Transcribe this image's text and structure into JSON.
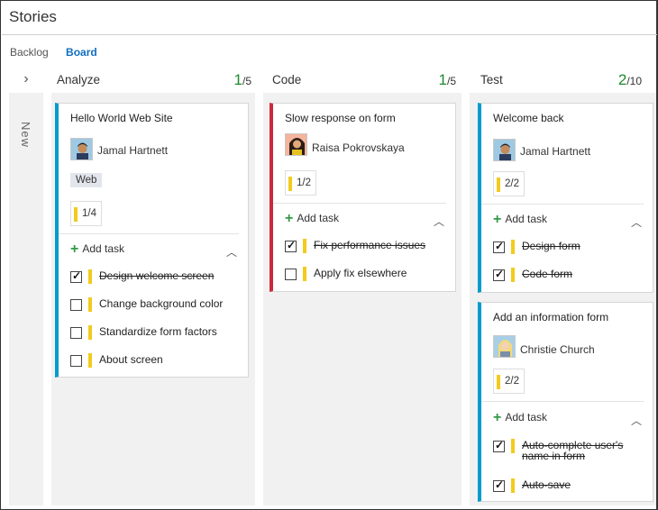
{
  "page": {
    "title": "Stories"
  },
  "tabs": [
    {
      "label": "Backlog"
    },
    {
      "label": "Board"
    }
  ],
  "new_column": {
    "label": "New"
  },
  "columns": [
    {
      "name": "Analyze",
      "count": "1",
      "limit": "/5"
    },
    {
      "name": "Code",
      "count": "1",
      "limit": "/5"
    },
    {
      "name": "Test",
      "count": "2",
      "limit": "/10"
    }
  ],
  "cards": {
    "hello_world": {
      "title": "Hello World Web Site",
      "assignee": "Jamal Hartnett",
      "tag": "Web",
      "progress": "1/4",
      "add_task": "Add task",
      "tasks": [
        {
          "name": "Design welcome screen",
          "done": true
        },
        {
          "name": "Change background color",
          "done": false
        },
        {
          "name": "Standardize form factors",
          "done": false
        },
        {
          "name": "About screen",
          "done": false
        }
      ]
    },
    "slow_response": {
      "title": "Slow response on form",
      "assignee": "Raisa Pokrovskaya",
      "progress": "1/2",
      "add_task": "Add task",
      "tasks": [
        {
          "name": "Fix performance issues",
          "done": true
        },
        {
          "name": "Apply fix elsewhere",
          "done": false
        }
      ]
    },
    "welcome_back": {
      "title": "Welcome back",
      "assignee": "Jamal Hartnett",
      "progress": "2/2",
      "add_task": "Add task",
      "tasks": [
        {
          "name": "Design form",
          "done": true
        },
        {
          "name": "Code form",
          "done": true
        }
      ]
    },
    "info_form": {
      "title": "Add an information form",
      "assignee": "Christie Church",
      "progress": "2/2",
      "add_task": "Add task",
      "tasks": [
        {
          "name": "Auto-complete user's",
          "name2": "name in form",
          "done": true
        },
        {
          "name": "Auto-save",
          "done": true
        }
      ]
    }
  },
  "colors": {
    "accent": "#106ebe",
    "wip_ok": "#1e8a2e",
    "story_blue": "#009ccc",
    "bug_red": "#cc293d",
    "task_yellow": "#f2cb1d"
  }
}
